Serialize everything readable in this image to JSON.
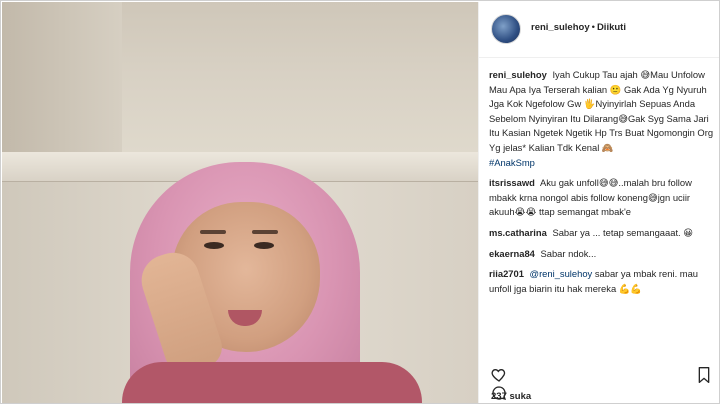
{
  "post": {
    "username": "reni_sulehoy",
    "follow_state": "Diikuti",
    "caption": {
      "text": "Iyah Cukup Tau ajah 😅Mau Unfolow Mau Apa Iya Terserah kalian 🙂 Gak Ada Yg Nyuruh Jga Kok Ngefolow Gw 🖐Nyinyirlah Sepuas Anda Sebelom Nyinyiran Itu Dilarang😅Gak Syg Sama Jari Itu Kasian Ngetek Ngetik Hp Trs Buat Ngomongin Org Yg jelas* Kalian Tdk Kenal 🙈",
      "hashtag": "#AnakSmp"
    },
    "likes": "237 suka"
  },
  "comments": [
    {
      "user": "itsrissawd",
      "text": "Aku gak unfoll😅😅..malah bru follow mbakk krna nongol abis follow koneng😅jgn uciir akuuh😭😭 ttap semangat mbak'e"
    },
    {
      "user": "ms.catharina",
      "text": "Sabar ya ... tetap semangaaat. 😀"
    },
    {
      "user": "ekaerna84",
      "text": "Sabar ndok..."
    },
    {
      "user": "riia2701",
      "mention": "@reni_sulehoy",
      "text": " sabar ya mbak reni. mau unfoll jga biarin itu hak mereka 💪💪"
    }
  ],
  "icons": {
    "avatar": "avatar",
    "like": "heart-icon",
    "comment": "comment-icon",
    "bookmark": "bookmark-icon"
  }
}
